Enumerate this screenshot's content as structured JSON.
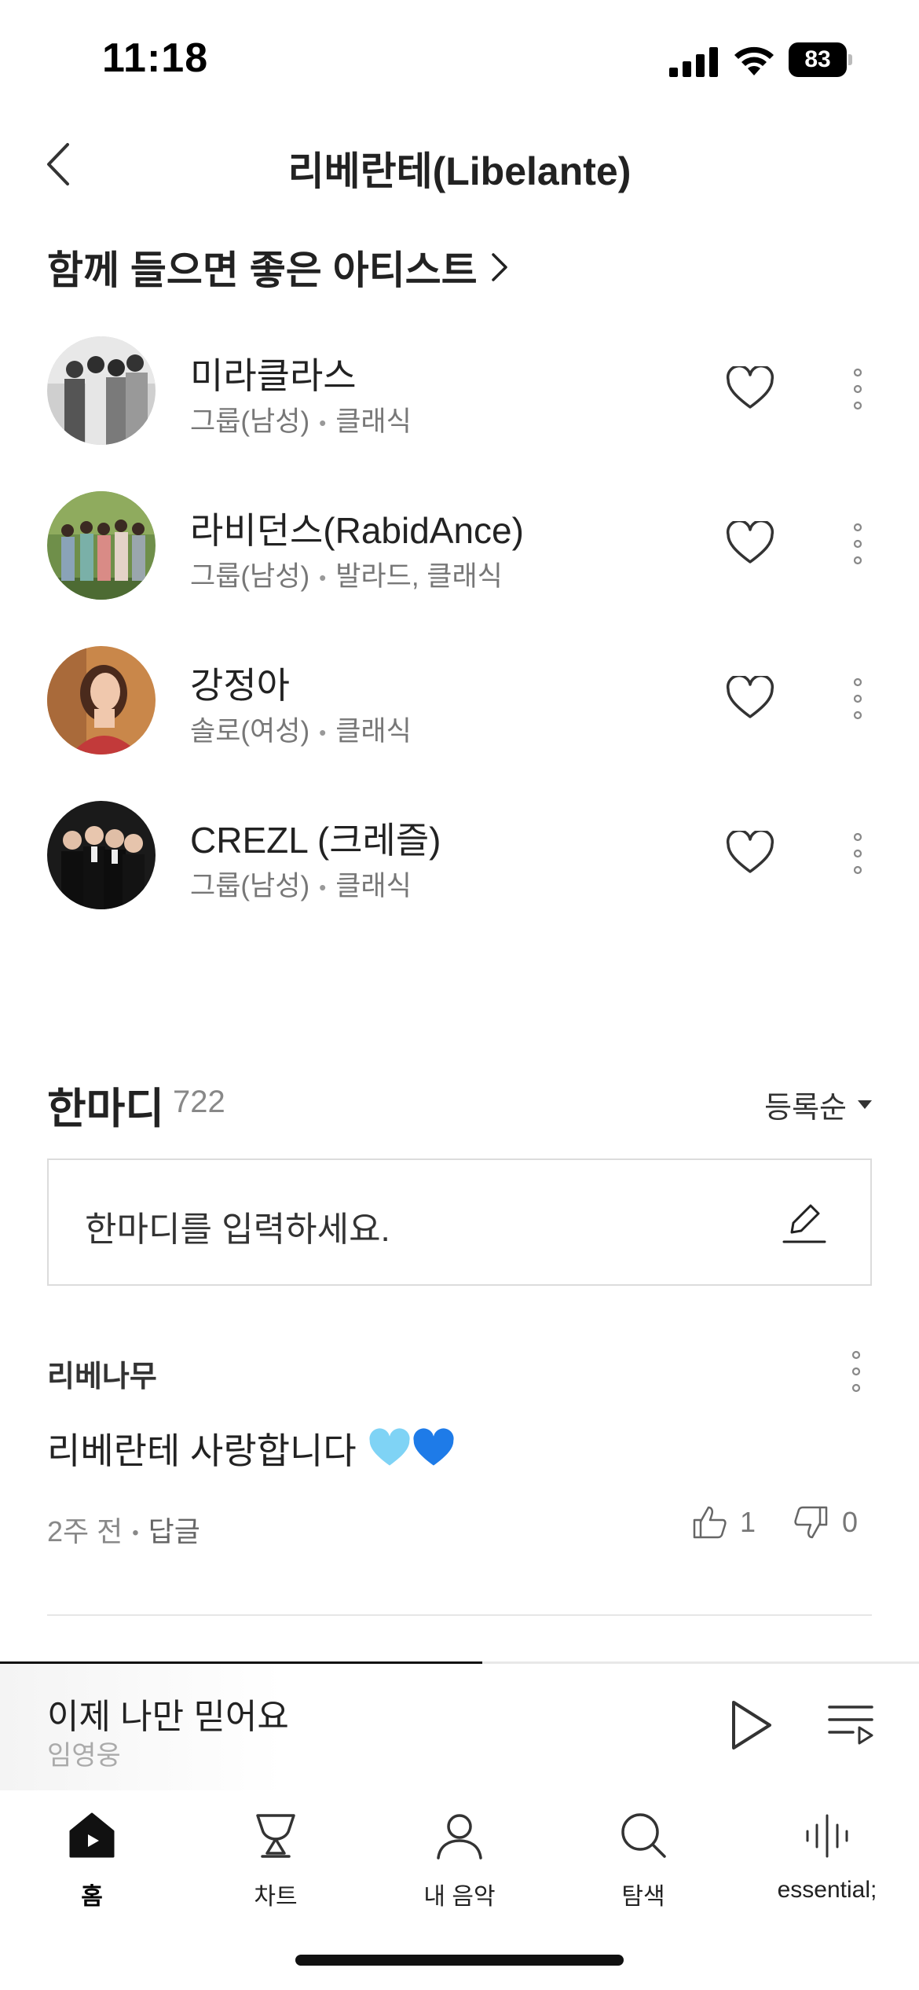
{
  "status_bar": {
    "time": "11:18",
    "battery": "83",
    "icons": [
      "signal-icon",
      "wifi-icon",
      "battery-icon"
    ]
  },
  "header": {
    "title": "리베란테(Libelante)",
    "back_icon": "chevron-left-icon"
  },
  "similar_artists": {
    "title": "함께 들으면 좋은 아티스트",
    "items": [
      {
        "name": "미라클라스",
        "type": "그룹(남성)",
        "genre": "클래식"
      },
      {
        "name": "라비던스(RabidAnce)",
        "type": "그룹(남성)",
        "genre": "발라드, 클래식"
      },
      {
        "name": "강정아",
        "type": "솔로(여성)",
        "genre": "클래식"
      },
      {
        "name": "CREZL (크레즐)",
        "type": "그룹(남성)",
        "genre": "클래식"
      }
    ]
  },
  "comments": {
    "title": "한마디",
    "count": "722",
    "sort": "등록순",
    "input_placeholder": "한마디를 입력하세요.",
    "items": [
      {
        "author": "리베나무",
        "text": "리베란테 사랑합니다",
        "time": "2주 전",
        "reply": "답글",
        "likes": "1",
        "dislikes": "0"
      }
    ]
  },
  "player": {
    "title": "이제 나만 믿어요",
    "artist": "임영웅",
    "progress": 0.525
  },
  "tabs": [
    {
      "label": "홈",
      "icon": "home-icon",
      "active": true
    },
    {
      "label": "차트",
      "icon": "trophy-icon",
      "active": false
    },
    {
      "label": "내 음악",
      "icon": "user-icon",
      "active": false
    },
    {
      "label": "탐색",
      "icon": "search-icon",
      "active": false
    },
    {
      "label": "essential;",
      "icon": "equalizer-icon",
      "active": false
    }
  ],
  "colors": {
    "text": "#222222",
    "meta": "#777777",
    "border": "#dcdcdc",
    "heart_emoji_light": "#7fd3f5",
    "heart_emoji_dark": "#1e7be8"
  }
}
